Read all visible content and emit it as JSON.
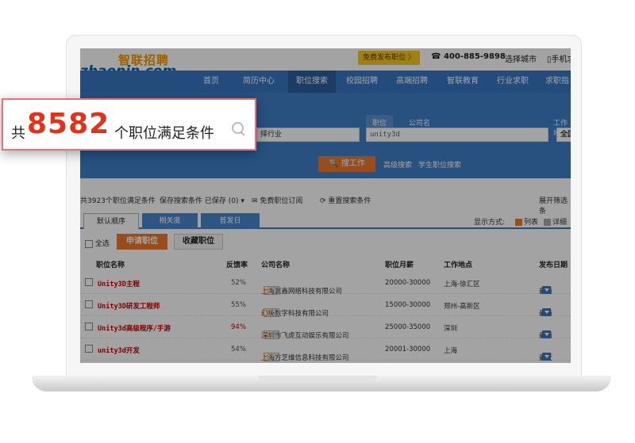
{
  "header": {
    "logo_cn": "智联招聘",
    "logo_en": "zhaopin.com",
    "free_post": "免费发布职位 〉",
    "phone": "☎ 400-885-9898",
    "city": "选择城市",
    "mobile": "▯手机求"
  },
  "nav": [
    "首页",
    "简历中心",
    "职位搜索",
    "校园招聘",
    "高端招聘",
    "智联教育",
    "行业求职",
    "求职指"
  ],
  "search": {
    "industry_value": "择行业",
    "tab_job": "职位",
    "tab_company": "公司名",
    "keyword_value": "unity3d",
    "location_label": "工作地",
    "location_value": "全国",
    "button": "搜工作",
    "advanced": "高级搜索",
    "campus": "学生职位搜索"
  },
  "filters": {
    "count_text": "共3923个职位满足条件",
    "save": "保存搜索条件  已保存 (0) ▾",
    "subscribe": "✉ 免费职位订阅",
    "reset": "⟳ 重置搜索条件",
    "expand": "展开筛选条"
  },
  "sort_tabs": [
    "默认顺序",
    "相关度",
    "首发日"
  ],
  "view": {
    "label": "显示方式:",
    "list": "列表",
    "detail": "详细"
  },
  "actions": {
    "select_all": "全选",
    "apply": "申请职位",
    "favorite": "收藏职位"
  },
  "table": {
    "columns": [
      "职位名称",
      "反馈率",
      "公司名称",
      "职位月薪",
      "工作地点",
      "发布日期"
    ],
    "rows": [
      {
        "title": "Unity3D主程",
        "rate": "52%",
        "company": "上海冀鑫网络科技有限公司",
        "salary": "20000-30000",
        "location": "上海-徐汇区",
        "date": "最新"
      },
      {
        "title": "Unity3D研发工程师",
        "rate": "55%",
        "company": "幻境数字科技有限公司",
        "salary": "15000-30000",
        "location": "郑州-高新区",
        "date": "最新"
      },
      {
        "title": "Unity3d高级程序/手游",
        "rate": "94%",
        "company": "深圳市飞虎互动娱乐有限公司",
        "salary": "25000-35000",
        "location": "深圳",
        "date": "最新"
      },
      {
        "title": "unity3d开发",
        "rate": "54%",
        "company": "上海方芝维信息科技有限公司",
        "salary": "20001-30000",
        "location": "上海",
        "date": "最近"
      }
    ],
    "badge": "会员"
  },
  "callout": {
    "prefix": "共",
    "number": "8582",
    "suffix": "个职位满足条件"
  },
  "colors": {
    "accent": "#3778c4",
    "highlight": "#e1331b",
    "orange": "#ee7b2c"
  }
}
